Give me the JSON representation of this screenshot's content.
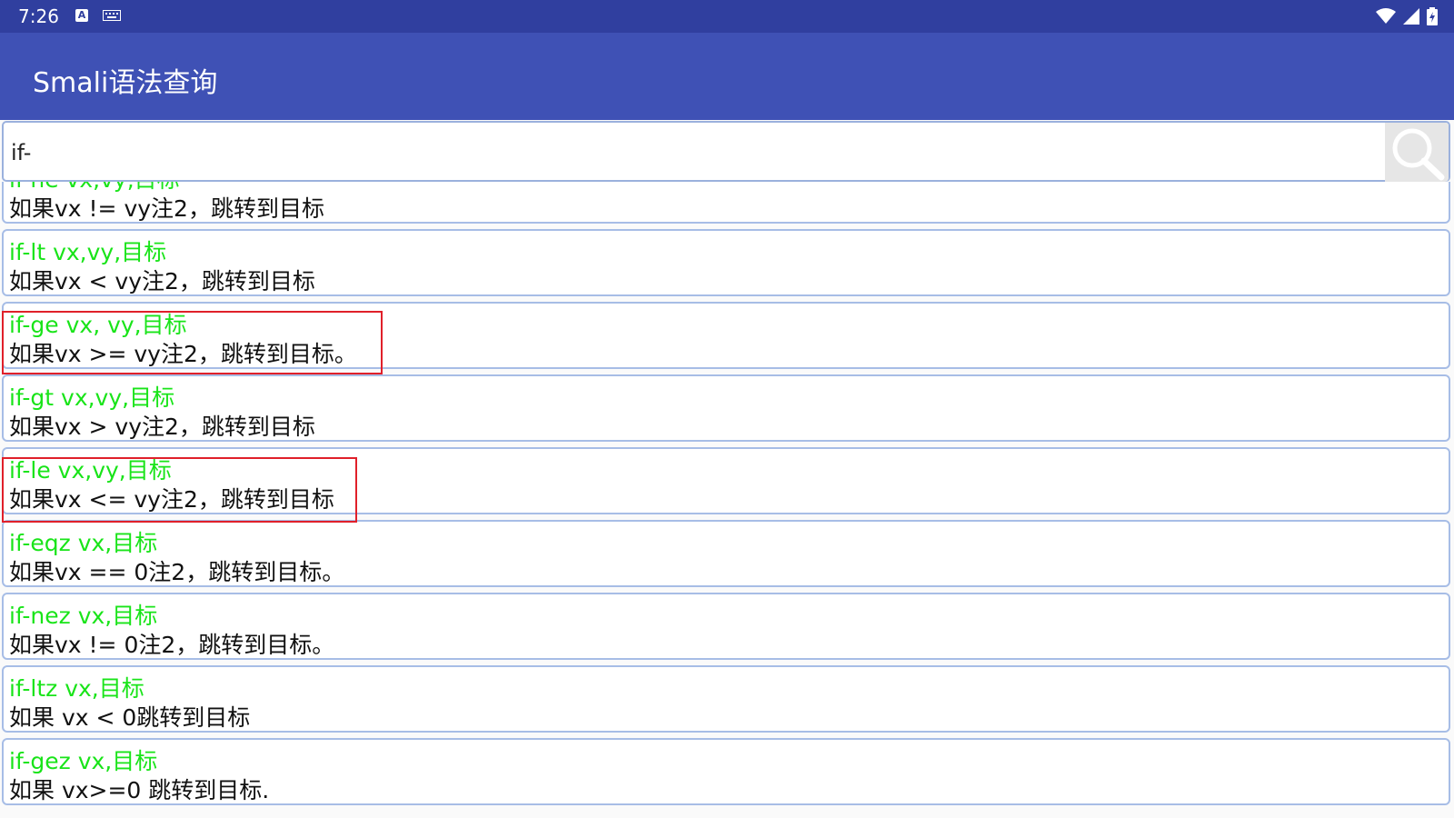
{
  "status_bar": {
    "time": "7:26",
    "icons": [
      "a-icon",
      "keyboard-icon",
      "wifi-icon",
      "signal-icon",
      "battery-icon"
    ]
  },
  "app_bar": {
    "title": "Smali语法查询",
    "color": "#3f51b5"
  },
  "search": {
    "value": "if-",
    "icon": "search-icon"
  },
  "results": [
    {
      "title": "if-ne vx,vy,目标",
      "desc": "如果vx != vy注2，跳转到目标"
    },
    {
      "title": "if-lt vx,vy,目标",
      "desc": "如果vx < vy注2，跳转到目标"
    },
    {
      "title": "if-ge vx, vy,目标",
      "desc": "如果vx >= vy注2，跳转到目标。"
    },
    {
      "title": "if-gt vx,vy,目标",
      "desc": "如果vx > vy注2，跳转到目标"
    },
    {
      "title": "if-le vx,vy,目标",
      "desc": "如果vx <= vy注2，跳转到目标"
    },
    {
      "title": "if-eqz vx,目标",
      "desc": "如果vx == 0注2，跳转到目标。"
    },
    {
      "title": "if-nez vx,目标",
      "desc": "如果vx != 0注2，跳转到目标。"
    },
    {
      "title": "if-ltz vx,目标",
      "desc": "如果 vx < 0跳转到目标"
    },
    {
      "title": "if-gez vx,目标",
      "desc": "如果 vx>=0 跳转到目标."
    }
  ],
  "colors": {
    "title_text": "#19e419",
    "desc_text": "#111111",
    "highlight_border": "#e0202a",
    "status_bar": "#303f9f"
  }
}
